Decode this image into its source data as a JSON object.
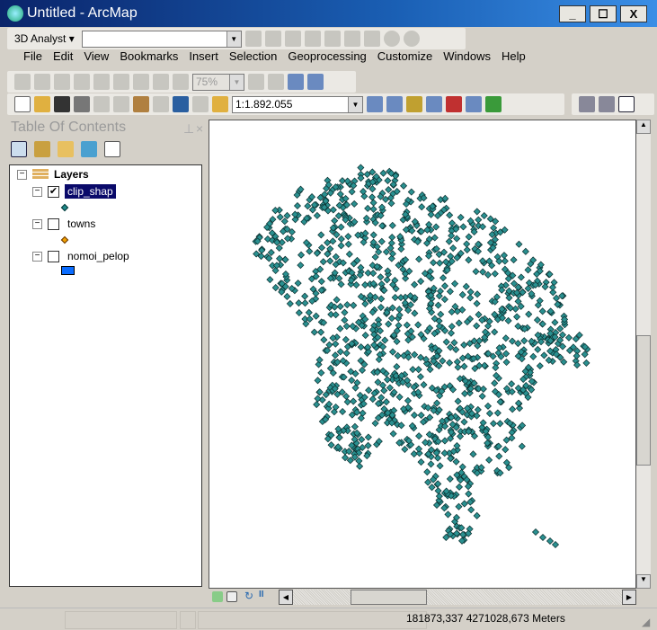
{
  "window": {
    "title": "Untitled - ArcMap",
    "minimize": "_",
    "maximize": "☐",
    "close": "X"
  },
  "toolbar_3d": {
    "label": "3D Analyst ▾",
    "layer_combo": ""
  },
  "menu": [
    "File",
    "Edit",
    "View",
    "Bookmarks",
    "Insert",
    "Selection",
    "Geoprocessing",
    "Customize",
    "Windows",
    "Help"
  ],
  "layout_toolbar": {
    "zoom_value": "75%"
  },
  "standard_toolbar": {
    "scale": "1:1.892.055"
  },
  "toc": {
    "title": "Table Of Contents",
    "root": "Layers",
    "layers": [
      {
        "name": "clip_shap",
        "checked": true,
        "selected": true,
        "symbol": "diamond",
        "color": "#1f8a8a"
      },
      {
        "name": "towns",
        "checked": false,
        "selected": false,
        "symbol": "diamond",
        "color": "#f0a000"
      },
      {
        "name": "nomoi_pelop",
        "checked": false,
        "selected": false,
        "symbol": "rect",
        "color": "#0a6cff"
      }
    ]
  },
  "map": {
    "point_color": "#2a9090",
    "point_outline": "#0b2e2e"
  },
  "status": {
    "coordinates": "181873,337  4271028,673 Meters"
  }
}
